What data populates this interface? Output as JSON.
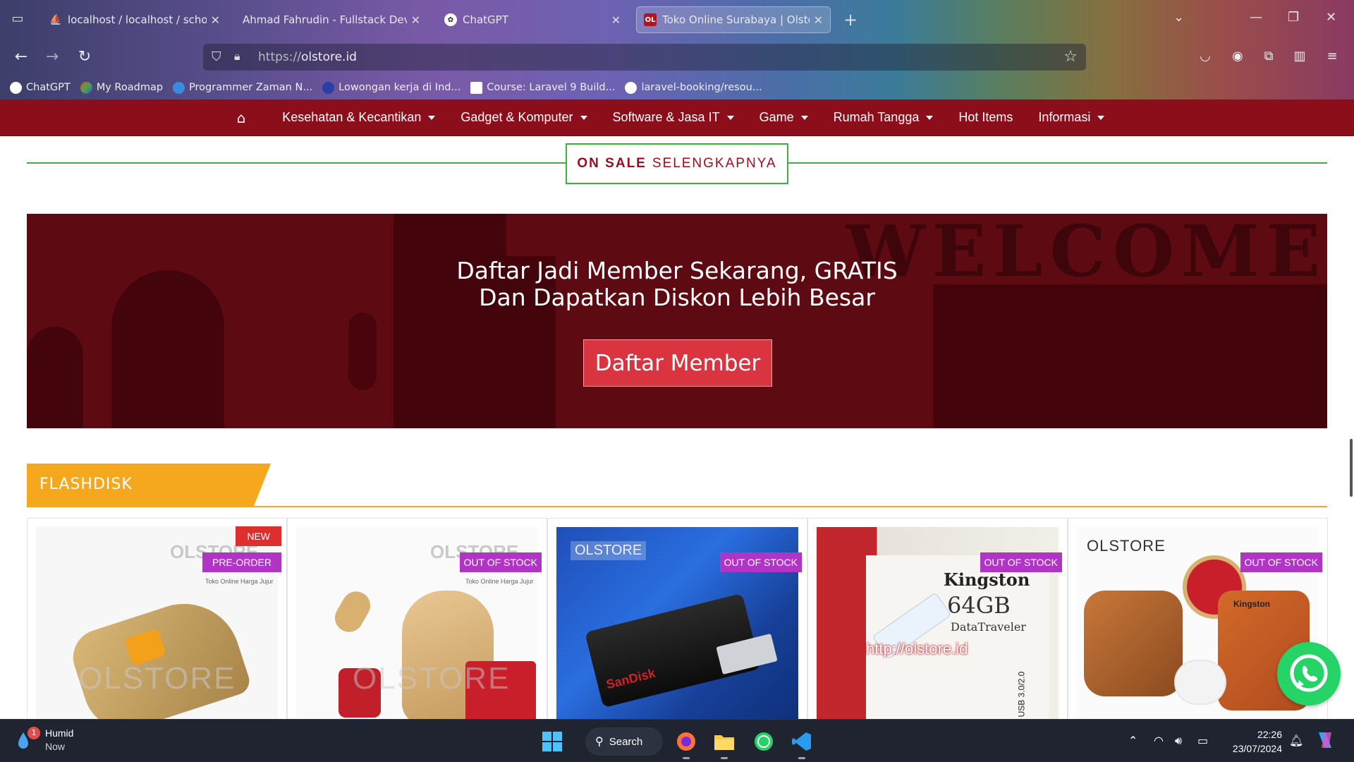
{
  "browser": {
    "tabs": [
      {
        "title": "localhost / localhost / school-m",
        "favicon": "phpmyadmin"
      },
      {
        "title": "Ahmad Fahrudin - Fullstack Develop",
        "favicon": "none"
      },
      {
        "title": "ChatGPT",
        "favicon": "chatgpt"
      },
      {
        "title": "Toko Online Surabaya | Olstore",
        "favicon": "OL",
        "active": true
      }
    ],
    "url_scheme": "https://",
    "url_host": "olstore.id",
    "bookmarks": [
      {
        "label": "ChatGPT"
      },
      {
        "label": "My Roadmap"
      },
      {
        "label": "Programmer Zaman N..."
      },
      {
        "label": "Lowongan kerja di Ind..."
      },
      {
        "label": "Course: Laravel 9 Build..."
      },
      {
        "label": "laravel-booking/resou..."
      }
    ]
  },
  "site": {
    "nav": [
      {
        "label": "Kesehatan & Kecantikan",
        "dropdown": true
      },
      {
        "label": "Gadget & Komputer",
        "dropdown": true
      },
      {
        "label": "Software & Jasa IT",
        "dropdown": true
      },
      {
        "label": "Game",
        "dropdown": true
      },
      {
        "label": "Rumah Tangga",
        "dropdown": true
      },
      {
        "label": "Hot Items",
        "dropdown": false
      },
      {
        "label": "Informasi",
        "dropdown": true
      }
    ],
    "on_sale": {
      "bold": "ON SALE",
      "rest": "SELENGKAPNYA"
    },
    "banner": {
      "line1": "Daftar Jadi Member Sekarang, GRATIS",
      "line2": "Dan Dapatkan Diskon Lebih Besar",
      "button": "Daftar Member",
      "bg_word": "WELCOME"
    },
    "section_title": "FLASHDISK",
    "products": [
      {
        "badges": [
          "NEW",
          "PRE-ORDER"
        ],
        "watermark": "OLSTORE",
        "tagline": "Toko Online Harga Jujur"
      },
      {
        "badges": [
          "OUT OF STOCK"
        ],
        "watermark": "OLSTORE",
        "tagline": "Toko Online Harga Jujur"
      },
      {
        "badges": [
          "OUT OF STOCK"
        ],
        "watermark": "OLSTORE",
        "brand": "SanDisk"
      },
      {
        "badges": [
          "OUT OF STOCK"
        ],
        "brand": "Kingston",
        "capacity": "64GB",
        "model": "DataTraveler",
        "url_overlay": "http://olstore.id",
        "usb": "USB 3.0/2.0"
      },
      {
        "badges": [
          "OUT OF STOCK"
        ],
        "watermark": "OLSTORE",
        "brand": "Kingston"
      }
    ]
  },
  "taskbar": {
    "weather": {
      "title": "Humid",
      "sub": "Now",
      "notifications": "1"
    },
    "search": "Search",
    "time": "22:26",
    "date": "23/07/2024"
  },
  "colors": {
    "nav_red": "#8b0e1a",
    "sale_green": "#3cb043",
    "banner_bg": "#5e0a12",
    "cta_red": "#d9343f",
    "section_orange": "#f5a81d",
    "stock_purple": "#b234c6",
    "new_red": "#e02d2d",
    "whatsapp_green": "#25d366"
  }
}
